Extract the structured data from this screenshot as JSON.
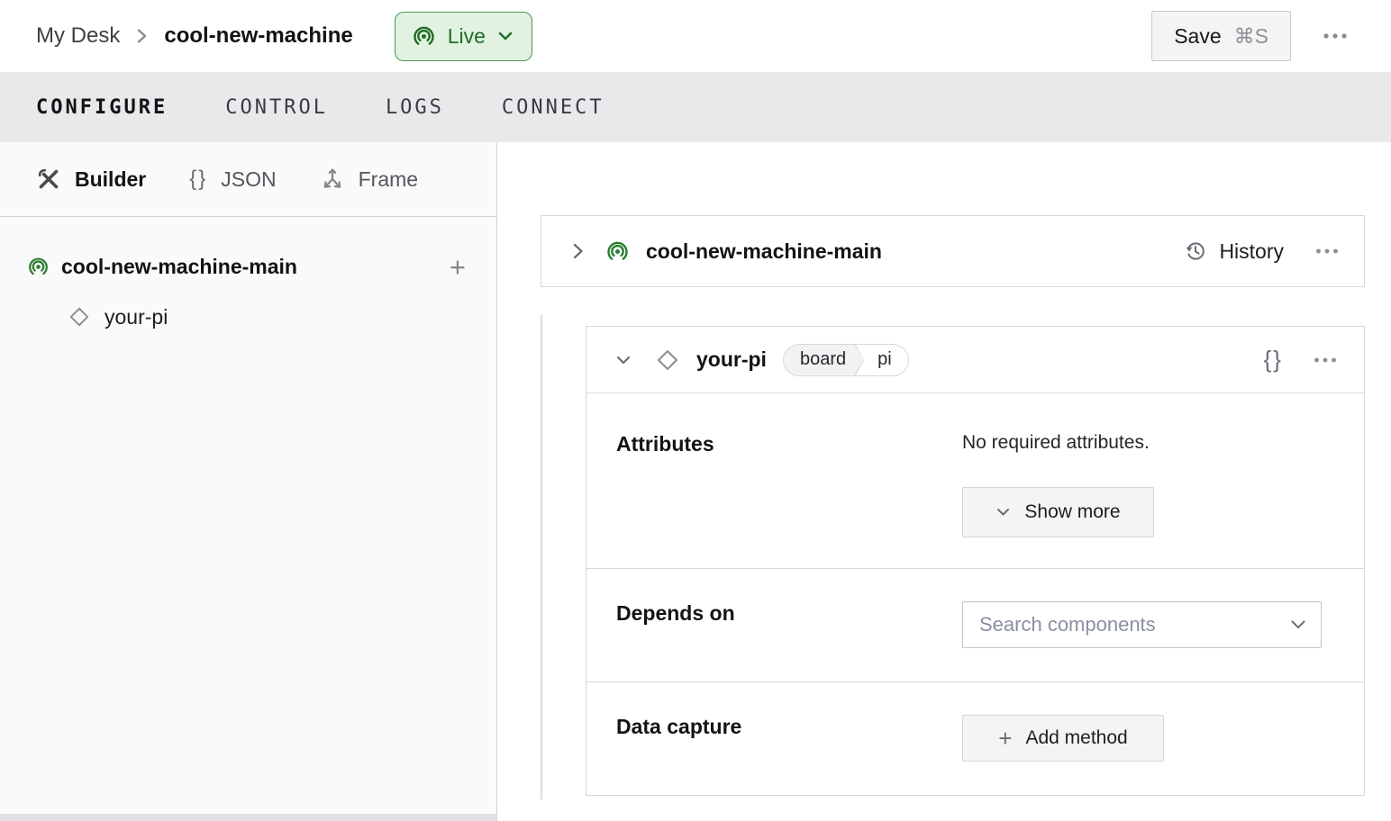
{
  "topbar": {
    "breadcrumb": {
      "parent": "My Desk",
      "current": "cool-new-machine"
    },
    "live_badge": {
      "label": "Live",
      "bg": "#e1f3e0",
      "border": "#4c9652",
      "text": "#1f6b26"
    },
    "save_button": {
      "label": "Save",
      "shortcut": "⌘S"
    }
  },
  "tabs": {
    "items": [
      {
        "label": "CONFIGURE",
        "active": true
      },
      {
        "label": "CONTROL",
        "active": false
      },
      {
        "label": "LOGS",
        "active": false
      },
      {
        "label": "CONNECT",
        "active": false
      }
    ]
  },
  "sidebar": {
    "view_switcher": {
      "items": [
        {
          "label": "Builder",
          "icon": "tools-icon",
          "active": true
        },
        {
          "label": "JSON",
          "icon": "braces-icon",
          "active": false
        },
        {
          "label": "Frame",
          "icon": "frame-axes-icon",
          "active": false
        }
      ]
    },
    "tree": {
      "machine": {
        "label": "cool-new-machine-main",
        "icon": "machine-online-icon"
      },
      "components": [
        {
          "label": "your-pi",
          "icon": "component-diamond-icon"
        }
      ]
    }
  },
  "main": {
    "machine_card": {
      "title": "cool-new-machine-main",
      "history_button": "History"
    },
    "component_card": {
      "title": "your-pi",
      "type_badge": {
        "type": "board",
        "model": "pi"
      },
      "attributes": {
        "label": "Attributes",
        "empty_message": "No required attributes.",
        "show_more_button": "Show more"
      },
      "depends_on": {
        "label": "Depends on",
        "search_placeholder": "Search components"
      },
      "data_capture": {
        "label": "Data capture",
        "add_method_button": "Add method"
      }
    }
  },
  "icons": {
    "braces_glyph": "{}",
    "plus_glyph": "+"
  },
  "colors": {
    "accent_green": "#2a7d2e",
    "tabbar_bg": "#e9e9eb",
    "sidebar_bg": "#fafafa",
    "card_border": "#d7d7db",
    "button_bg": "#f4f4f5"
  }
}
